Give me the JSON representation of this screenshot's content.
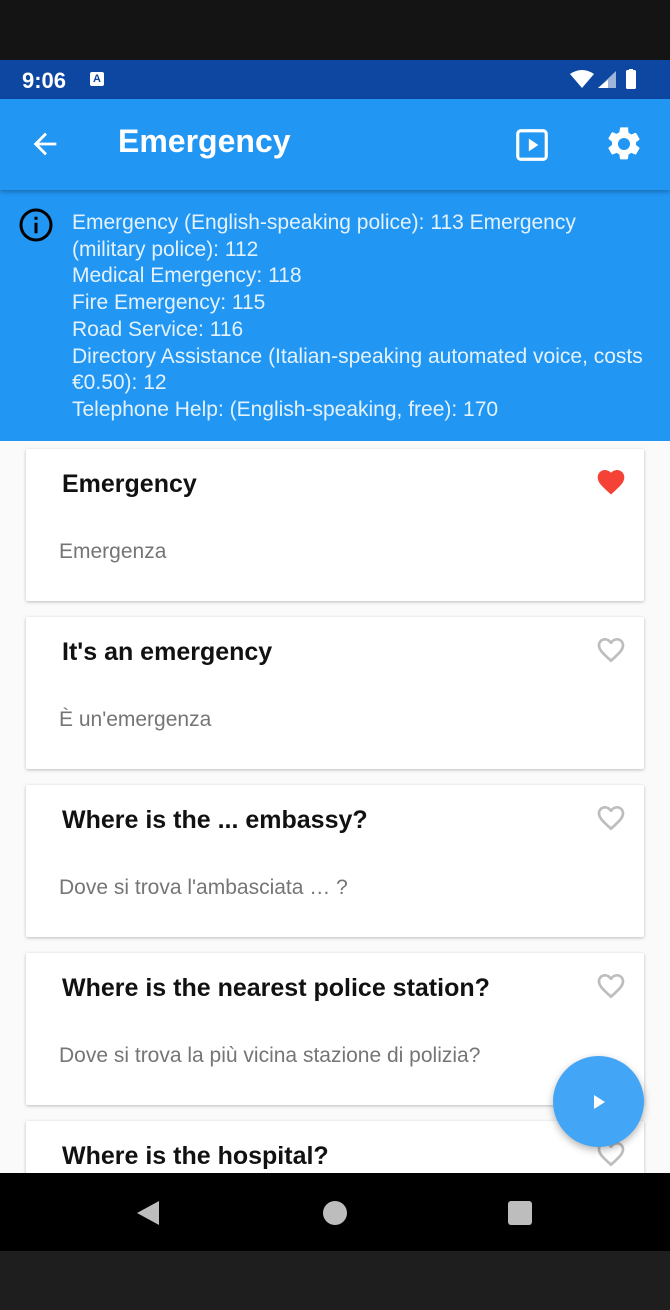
{
  "status": {
    "time": "9:06",
    "notification_icon": "A"
  },
  "app_bar": {
    "title": "Emergency"
  },
  "info": {
    "lines": [
      "Emergency (English-speaking police): 113 Emergency (military police): 112",
      "Medical Emergency: 118",
      "Fire Emergency: 115",
      "Road Service: 116",
      "Directory Assistance (Italian-speaking automated voice, costs €0.50): 12",
      "Telephone Help: (English-speaking, free): 170"
    ]
  },
  "phrases": [
    {
      "english": "Emergency",
      "italian": "Emergenza",
      "favorite": true
    },
    {
      "english": "It's an emergency",
      "italian": "È un'emergenza",
      "favorite": false
    },
    {
      "english": "Where is the ... embassy?",
      "italian": "Dove si trova l'ambasciata … ?",
      "favorite": false
    },
    {
      "english": "Where is the nearest police station?",
      "italian": "Dove si trova la più vicina stazione di polizia?",
      "favorite": false
    },
    {
      "english": "Where is the hospital?",
      "italian": "",
      "favorite": false
    }
  ],
  "colors": {
    "primary": "#2196f3",
    "status_bar": "#0d47a1",
    "heart_active": "#f44336",
    "fab": "#42a5f5"
  }
}
